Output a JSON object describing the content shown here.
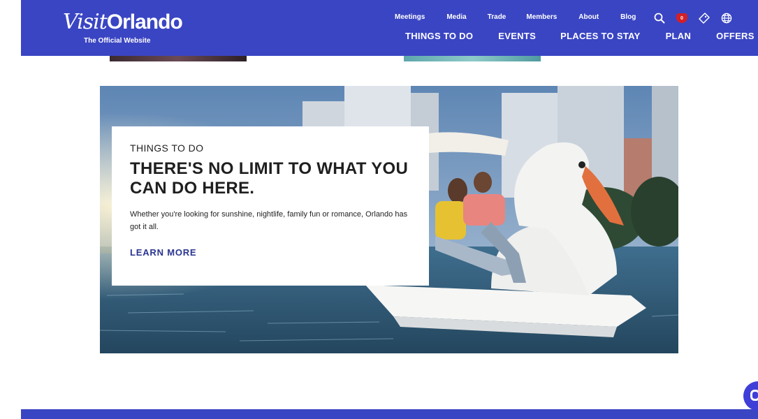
{
  "site": {
    "logo": {
      "visit": "Visit",
      "orlando": "Orlando",
      "tagline": "The Official Website"
    }
  },
  "utility_nav": [
    "Meetings",
    "Media",
    "Trade",
    "Members",
    "About",
    "Blog"
  ],
  "icons": {
    "search": "search-icon",
    "favorites": "heart-icon",
    "favorites_count": "0",
    "tickets": "ticket-icon",
    "language": "globe-icon"
  },
  "main_nav": [
    "THINGS TO DO",
    "EVENTS",
    "PLACES TO STAY",
    "PLAN",
    "OFFERS"
  ],
  "hero": {
    "eyebrow": "THINGS TO DO",
    "headline": "THERE'S NO LIMIT TO WHAT YOU CAN DO HERE.",
    "body": "Whether you're looking for sunshine, nightlife, family fun or romance, Orlando has got it all.",
    "cta": "LEARN MORE"
  },
  "colors": {
    "brand": "#3a45c3",
    "cta": "#2a3590",
    "badge": "#d42027"
  }
}
